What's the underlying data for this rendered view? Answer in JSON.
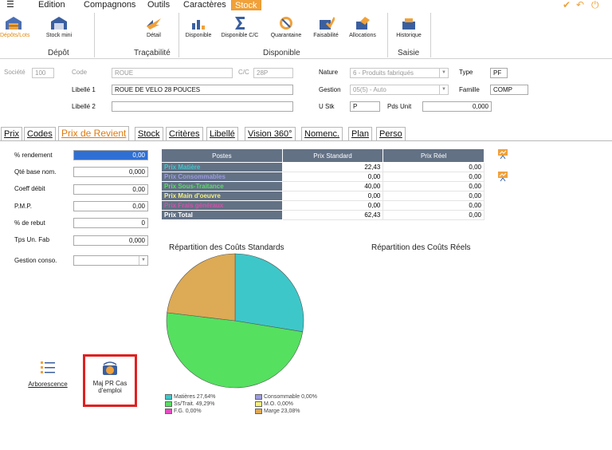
{
  "menubar": {
    "items": [
      "Edition",
      "Compagnons",
      "Outils",
      "Caractères",
      "Stock"
    ],
    "active": "Stock"
  },
  "ribbon": {
    "depot_group": {
      "label": "Dépôt",
      "buttons": [
        "Dépôts/Lots",
        "Stock mini"
      ]
    },
    "tracabilite_group": {
      "label": "Traçabilité",
      "buttons": [
        "Détail"
      ]
    },
    "disponible_group": {
      "label": "Disponible",
      "buttons": [
        "Disponible",
        "Disponible C/C",
        "Quarantaine",
        "Faisabilité",
        "Allocations"
      ]
    },
    "saisie_group": {
      "label": "Saisie",
      "buttons": [
        "Historique"
      ]
    }
  },
  "header": {
    "societe_label": "Société",
    "societe_value": "100",
    "code_label": "Code",
    "code_value": "ROUE",
    "cc_label": "C/C",
    "cc_value": "28P",
    "libelle1_label": "Libellé 1",
    "libelle1_value": "ROUE DE VELO 28 POUCES",
    "libelle2_label": "Libellé 2",
    "libelle2_value": "",
    "nature_label": "Nature",
    "nature_value": "6 - Produits fabriqués",
    "type_label": "Type",
    "type_value": "PF",
    "gestion_label": "Gestion",
    "gestion_value": "05(5) - Auto",
    "famille_label": "Famille",
    "famille_value": "COMP",
    "ustk_label": "U Stk",
    "ustk_value": "P",
    "pdsunit_label": "Pds Unit",
    "pdsunit_value": "0,000"
  },
  "tabs": [
    "Prix",
    "Codes",
    "Prix de Revient",
    "Stock",
    "Critères",
    "Libellé",
    "Vision 360°",
    "Nomenc.",
    "Plan",
    "Perso"
  ],
  "active_tab": "Prix de Revient",
  "form": {
    "rendement_label": "% rendement",
    "rendement_value": "0,00",
    "qte_label": "Qté base nom.",
    "qte_value": "0,000",
    "coeff_label": "Coeff débit",
    "coeff_value": "0,00",
    "pmp_label": "P.M.P.",
    "pmp_value": "0,00",
    "rebut_label": "% de rebut",
    "rebut_value": "0",
    "tps_label": "Tps Un. Fab",
    "tps_value": "0,000",
    "gestion_conso_label": "Gestion conso.",
    "gestion_conso_value": ""
  },
  "cost_table": {
    "headers": [
      "Postes",
      "Prix Standard",
      "Prix Réel"
    ],
    "rows": [
      {
        "label": "Prix Matière",
        "color": "#3ec7c9",
        "standard": "22,43",
        "reel": "0,00"
      },
      {
        "label": "Prix Consommables",
        "color": "#9b9be0",
        "standard": "0,00",
        "reel": "0,00"
      },
      {
        "label": "Prix Sous-Traitance",
        "color": "#55e060",
        "standard": "40,00",
        "reel": "0,00"
      },
      {
        "label": "Prix Main d'oeuvre",
        "color": "#f3f07a",
        "standard": "0,00",
        "reel": "0,00"
      },
      {
        "label": "Prix Frais généraux",
        "color": "#d64fa8",
        "standard": "0,00",
        "reel": "0,00"
      },
      {
        "label": "Prix Total",
        "color": "#ffffff",
        "standard": "62,43",
        "reel": "0,00"
      }
    ]
  },
  "chart_titles": {
    "standard": "Répartition des Coûts Standards",
    "reel": "Répartition des Coûts Réels"
  },
  "chart_data": {
    "type": "pie",
    "title": "Répartition des Coûts Standards",
    "categories": [
      "Matières",
      "Consommable",
      "Ss/Trait.",
      "M.O.",
      "F.G.",
      "Marge"
    ],
    "values": [
      27.64,
      0.0,
      49.29,
      0.0,
      0.0,
      23.08
    ],
    "colors": [
      "#3ec7c9",
      "#9b9be0",
      "#55e060",
      "#f5f07a",
      "#e04fc0",
      "#ddaa55"
    ],
    "legend_labels": [
      "Matières 27,64%",
      "Consommable 0,00%",
      "Ss/Trait. 49,29%",
      "M.O. 0,00%",
      "F.G. 0,00%",
      "Marge 23,08%"
    ]
  },
  "tools": {
    "arborescence": "Arborescence",
    "maj_line1": "Maj PR Cas",
    "maj_line2": "d'emploi"
  }
}
